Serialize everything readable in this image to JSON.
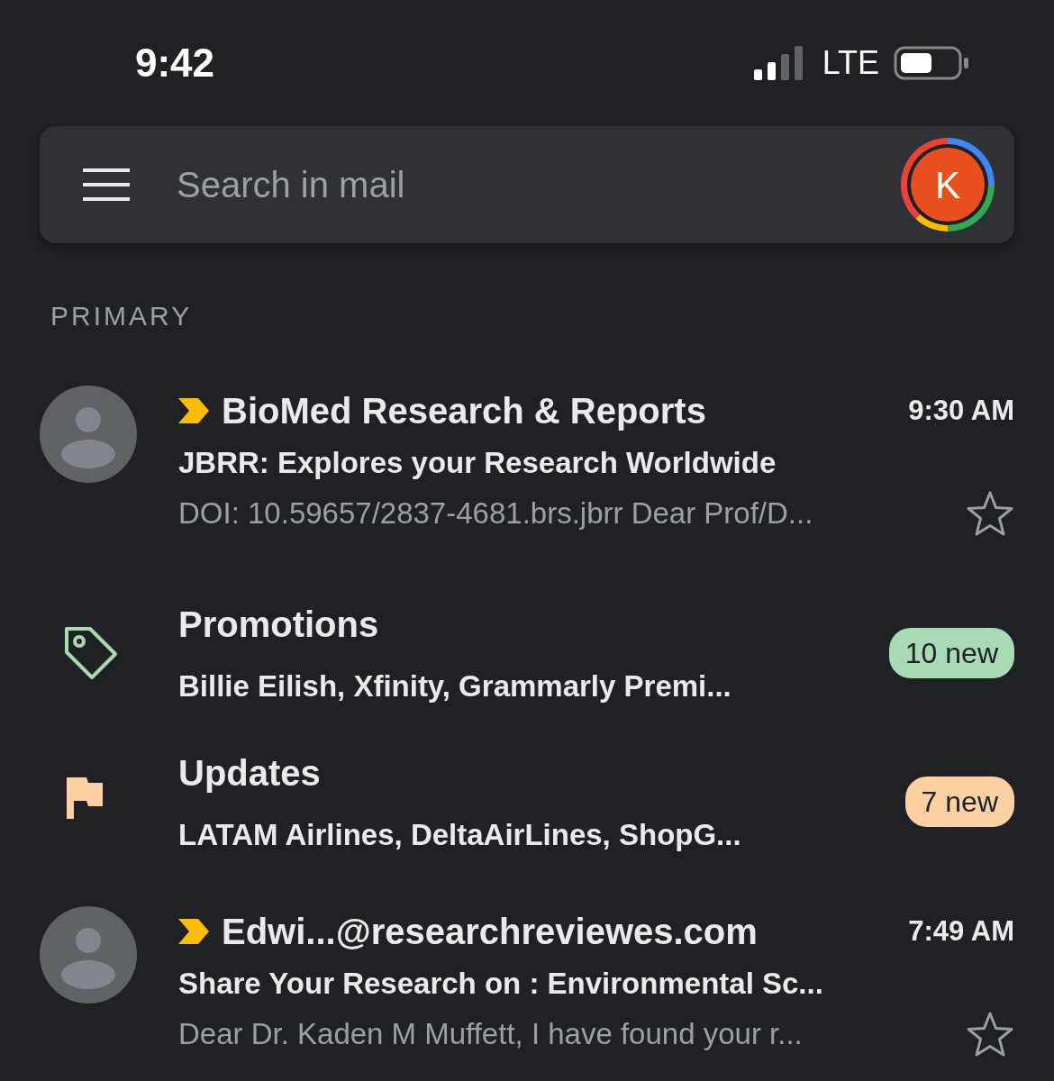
{
  "status_bar": {
    "time": "9:42",
    "network": "LTE"
  },
  "search": {
    "placeholder": "Search in mail",
    "avatar_letter": "K"
  },
  "section": "PRIMARY",
  "items": [
    {
      "kind": "email",
      "important": true,
      "unread": true,
      "sender": "BioMed Research & Reports",
      "time": "9:30 AM",
      "subject": "JBRR: Explores your Research Worldwide",
      "snippet": "DOI: 10.59657/2837-4681.brs.jbrr Dear Prof/D...",
      "starred": false
    },
    {
      "kind": "promotions",
      "title": "Promotions",
      "senders": "Billie Eilish, Xfinity, Grammarly Premi...",
      "badge": "10 new",
      "color": "#a8dab5"
    },
    {
      "kind": "updates",
      "title": "Updates",
      "senders": "LATAM Airlines, DeltaAirLines, ShopG...",
      "badge": "7 new",
      "color": "#fdcfa3"
    },
    {
      "kind": "email",
      "important": true,
      "unread": true,
      "sender": "Edwi...@researchreviewes.com",
      "time": "7:49 AM",
      "subject": "Share Your Research on : Environmental Sc...",
      "snippet": "Dear Dr. Kaden M Muffett, I have found your r...",
      "starred": false
    }
  ]
}
